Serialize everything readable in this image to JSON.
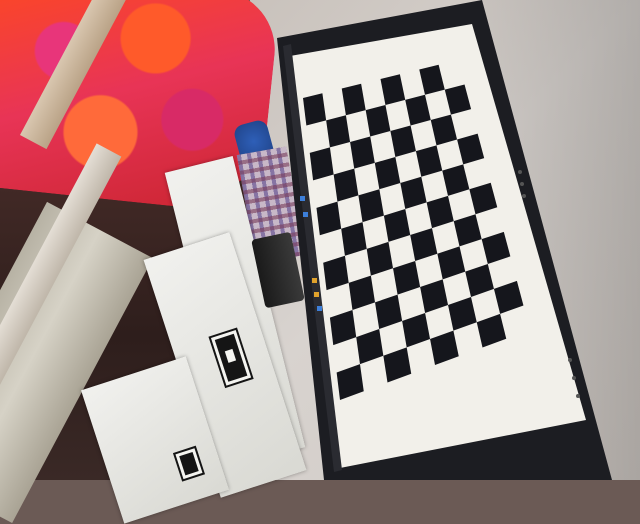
{
  "scene": {
    "description_tags": [
      "monitor-with-checkerboard",
      "printed-markers",
      "fabric",
      "desk"
    ]
  },
  "checkerboard": {
    "rows": 11,
    "cols": 8,
    "dark_color": "#15161c",
    "light_color": "#f2f0ea"
  },
  "colors": {
    "bezel": "#1c1d22",
    "fabric_red": "#ff4a1e",
    "fabric_pink": "#e8357a",
    "wall": "#d2ccc6"
  }
}
